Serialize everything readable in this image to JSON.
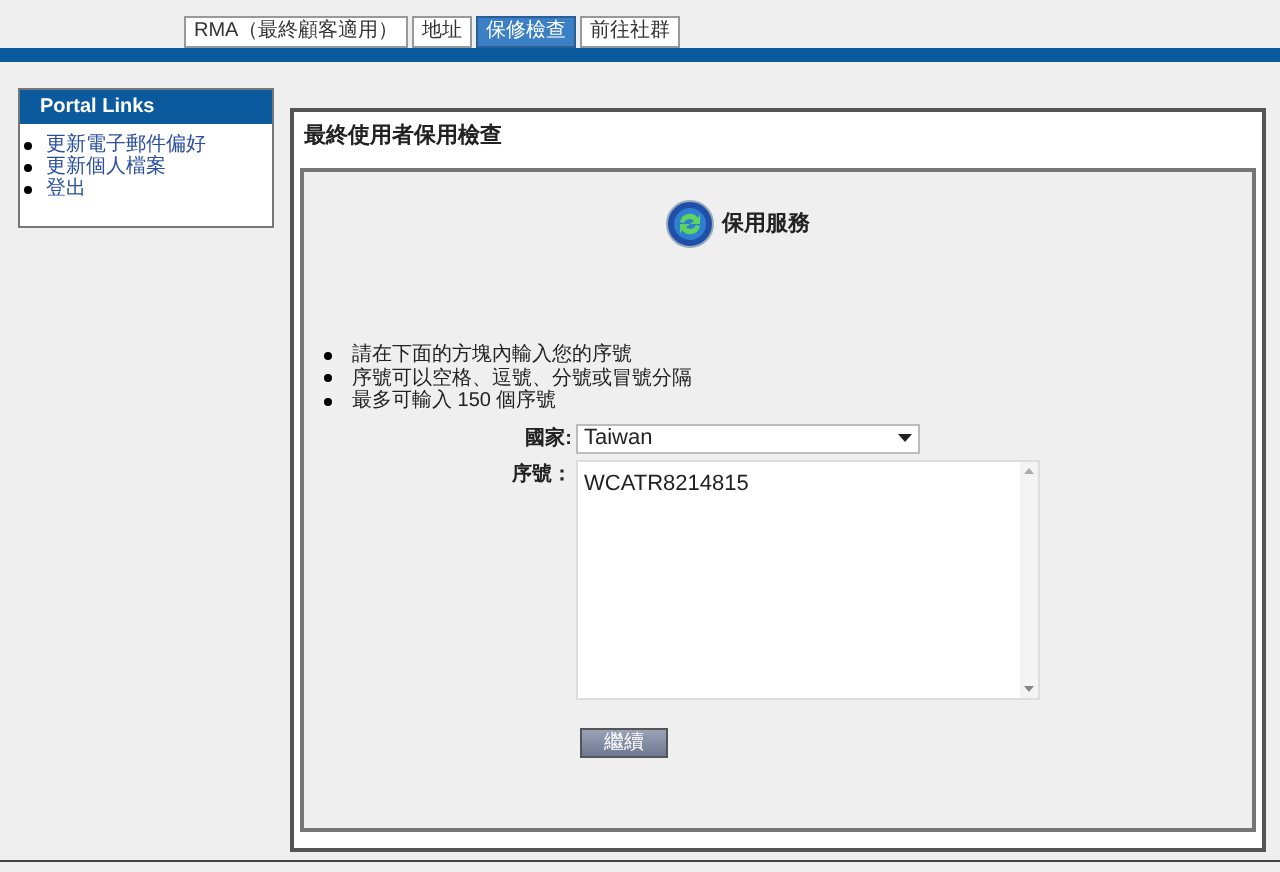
{
  "tabs": [
    {
      "label": "RMA（最終顧客適用）",
      "selected": false
    },
    {
      "label": "地址",
      "selected": false
    },
    {
      "label": "保修檢查",
      "selected": true
    },
    {
      "label": "前往社群",
      "selected": false
    }
  ],
  "sidebar": {
    "title": "Portal Links",
    "items": [
      "更新電子郵件偏好",
      "更新個人檔案",
      "登出"
    ]
  },
  "panel": {
    "title": "最終使用者保用檢查",
    "service_title": "保用服務",
    "instructions": [
      "請在下面的方塊內輸入您的序號",
      "序號可以空格、逗號、分號或冒號分隔",
      "最多可輸入 150 個序號"
    ],
    "country_label": "國家:",
    "country_value": "Taiwan",
    "serial_label": "序號：",
    "serial_value": "WCATR8214815",
    "continue_button": "繼續"
  }
}
